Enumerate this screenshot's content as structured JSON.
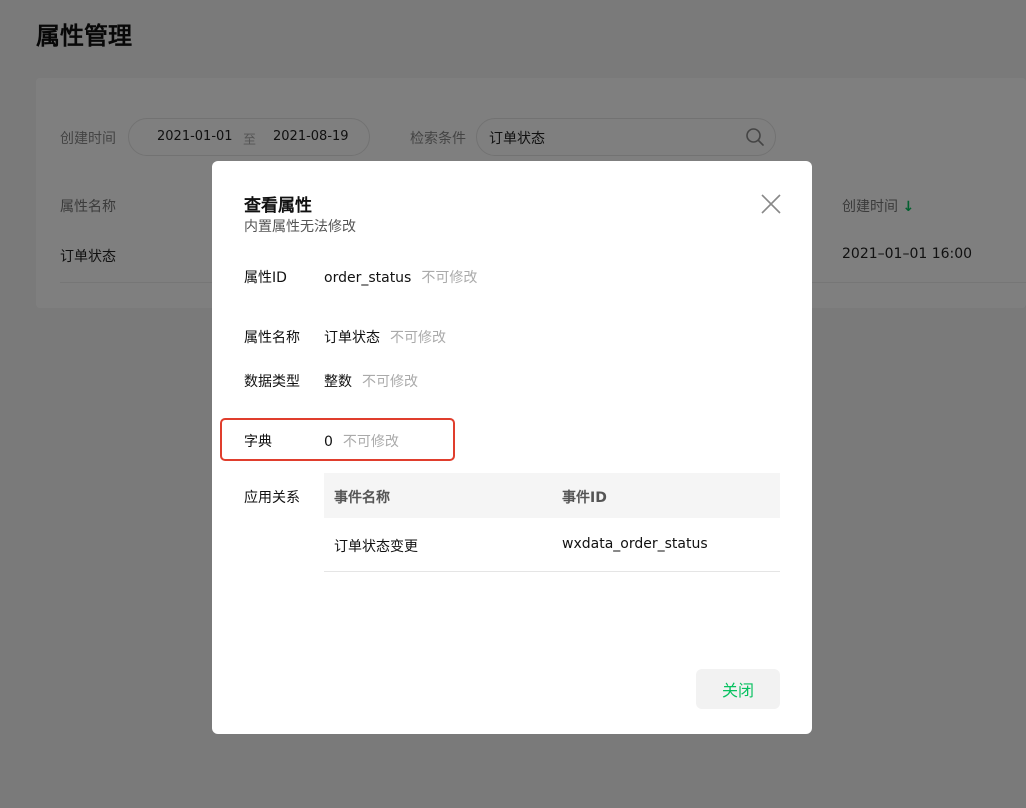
{
  "page": {
    "title": "属性管理"
  },
  "filters": {
    "created_label": "创建时间",
    "date_start": "2021-01-01",
    "date_sep": "至",
    "date_end": "2021-08-19",
    "search_label": "检索条件",
    "search_value": "订单状态"
  },
  "table": {
    "columns": [
      "属性名称",
      "创建时间"
    ],
    "sort_arrow": "↓",
    "rows": [
      {
        "name": "订单状态",
        "created": "2021–01–01 16:00"
      }
    ]
  },
  "dialog": {
    "title": "查看属性",
    "subtitle": "内置属性无法修改",
    "readonly_hint": "不可修改",
    "fields": [
      {
        "label": "属性ID",
        "value": "order_status"
      },
      {
        "label": "属性名称",
        "value": "订单状态"
      },
      {
        "label": "数据类型",
        "value": "整数"
      },
      {
        "label": "字典",
        "value": "0"
      }
    ],
    "relations_label": "应用关系",
    "relations": {
      "columns": [
        "事件名称",
        "事件ID"
      ],
      "rows": [
        {
          "name": "订单状态变更",
          "id": "wxdata_order_status"
        }
      ]
    },
    "close_label": "关闭"
  },
  "colors": {
    "accent": "#07c160",
    "highlight": "#e03e2d"
  }
}
